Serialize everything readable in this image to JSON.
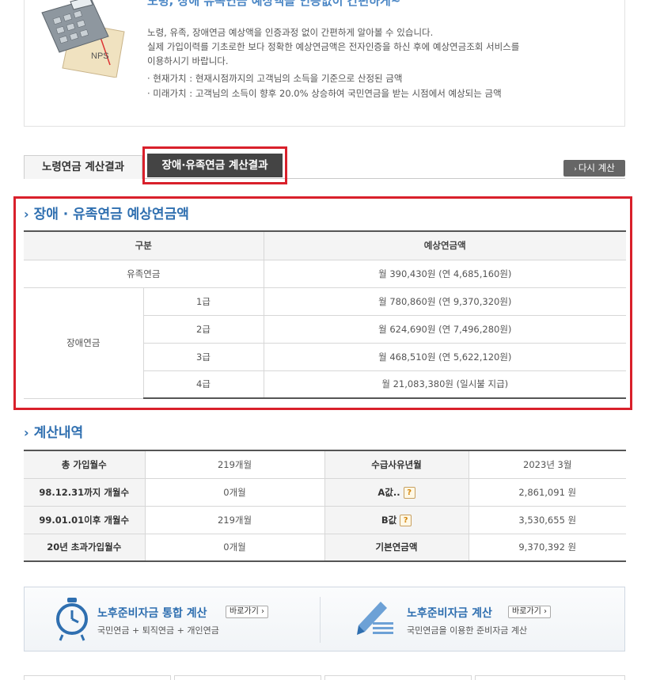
{
  "intro": {
    "headline": "노령, 장애 유족연금 예상액을 인증없이 간편하게~",
    "desc": [
      "노령, 유족, 장애연금 예상액을 인증과정 없이 간편하게 알아볼 수 있습니다.",
      "실제 가입이력를 기초로한 보다 정확한 예상연금액은 전자인증을 하신 후에 예상연금조회 서비스를",
      "이용하시기 바랍니다."
    ],
    "defs": [
      "· 현재가치 : 현재시점까지의 고객님의 소득을 기준으로 산정된 금액",
      "· 미래가치 : 고객님의 소득이 향후 20.0% 상승하여 국민연금을 받는 시점에서 예상되는 금액"
    ],
    "image_label": "NPS"
  },
  "tabs": {
    "tab1": "노령연금 계산결과",
    "tab2": "장애·유족연금 계산결과",
    "redo": "다시 계산"
  },
  "section1": {
    "title": "장애 · 유족연금 예상연금액",
    "headers": [
      "구분",
      "예상연금액"
    ],
    "survivor": {
      "label": "유족연금",
      "amount": "월 390,430원 (연 4,685,160원)"
    },
    "disability_label": "장애연금",
    "grades": [
      {
        "grade": "1급",
        "amount": "월 780,860원 (연 9,370,320원)"
      },
      {
        "grade": "2급",
        "amount": "월 624,690원 (연 7,496,280원)"
      },
      {
        "grade": "3급",
        "amount": "월 468,510원 (연 5,622,120원)"
      },
      {
        "grade": "4급",
        "amount": "월 21,083,380원 (일시불 지급)"
      }
    ]
  },
  "section2": {
    "title": "계산내역",
    "rows": [
      {
        "l1": "총 가입월수",
        "v1": "219개월",
        "l2": "수급사유년월",
        "v2": "2023년 3월"
      },
      {
        "l1": "98.12.31까지 개월수",
        "v1": "0개월",
        "l2": "A값..",
        "v2": "2,861,091 원"
      },
      {
        "l1": "99.01.01이후 개월수",
        "v1": "219개월",
        "l2": "B값",
        "v2": "3,530,655 원"
      },
      {
        "l1": "20년 초과가입월수",
        "v1": "0개월",
        "l2": "기본연금액",
        "v2": "9,370,392 원"
      }
    ],
    "help_glyph": "?"
  },
  "banner": {
    "left": {
      "title": "노후준비자금 통합 계산",
      "button": "바로가기 ›",
      "sub": "국민연금 + 퇴직연금 + 개인연금"
    },
    "right": {
      "title": "노후준비자금 계산",
      "button": "바로가기 ›",
      "sub": "국민연금을 이용한 준비자금 계산"
    }
  },
  "colors": {
    "accent_blue": "#2f6fb0",
    "highlight_red": "#d9202b",
    "tab_active": "#444444"
  }
}
